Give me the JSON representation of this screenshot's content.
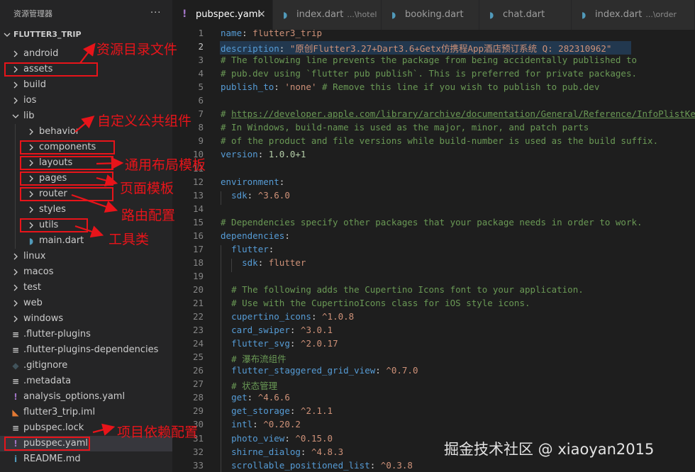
{
  "explorer": {
    "title": "资源管理器",
    "more": "···",
    "root": "FLUTTER3_TRIP",
    "items": [
      {
        "label": "android",
        "type": "folder",
        "icon": "chevron-right-icon"
      },
      {
        "label": "assets",
        "type": "folder",
        "icon": "chevron-right-icon"
      },
      {
        "label": "build",
        "type": "folder",
        "icon": "chevron-right-icon"
      },
      {
        "label": "ios",
        "type": "folder",
        "icon": "chevron-right-icon"
      },
      {
        "label": "lib",
        "type": "folder-open",
        "icon": "chevron-down-icon"
      },
      {
        "label": "behavior",
        "type": "folder",
        "icon": "chevron-right-icon"
      },
      {
        "label": "components",
        "type": "folder",
        "icon": "chevron-right-icon"
      },
      {
        "label": "layouts",
        "type": "folder",
        "icon": "chevron-right-icon"
      },
      {
        "label": "pages",
        "type": "folder",
        "icon": "chevron-right-icon"
      },
      {
        "label": "router",
        "type": "folder",
        "icon": "chevron-right-icon"
      },
      {
        "label": "styles",
        "type": "folder",
        "icon": "chevron-right-icon"
      },
      {
        "label": "utils",
        "type": "folder",
        "icon": "chevron-right-icon"
      },
      {
        "label": "main.dart",
        "type": "dart",
        "icon": "dart-file-icon"
      },
      {
        "label": "linux",
        "type": "folder",
        "icon": "chevron-right-icon"
      },
      {
        "label": "macos",
        "type": "folder",
        "icon": "chevron-right-icon"
      },
      {
        "label": "test",
        "type": "folder",
        "icon": "chevron-right-icon"
      },
      {
        "label": "web",
        "type": "folder",
        "icon": "chevron-right-icon"
      },
      {
        "label": "windows",
        "type": "folder",
        "icon": "chevron-right-icon"
      },
      {
        "label": ".flutter-plugins",
        "type": "lines",
        "icon": "text-file-icon"
      },
      {
        "label": ".flutter-plugins-dependencies",
        "type": "lines",
        "icon": "text-file-icon"
      },
      {
        "label": ".gitignore",
        "type": "git",
        "icon": "git-file-icon"
      },
      {
        "label": ".metadata",
        "type": "lines",
        "icon": "text-file-icon"
      },
      {
        "label": "analysis_options.yaml",
        "type": "yaml",
        "icon": "yaml-file-icon"
      },
      {
        "label": "flutter3_trip.iml",
        "type": "iml",
        "icon": "rss-file-icon"
      },
      {
        "label": "pubspec.lock",
        "type": "lines",
        "icon": "text-file-icon"
      },
      {
        "label": "pubspec.yaml",
        "type": "yaml",
        "icon": "yaml-file-icon",
        "selected": true
      },
      {
        "label": "README.md",
        "type": "info",
        "icon": "info-file-icon"
      }
    ]
  },
  "tabs": [
    {
      "label": "pubspec.yaml",
      "desc": "",
      "icon": "yaml-file-icon",
      "active": true,
      "close": "×"
    },
    {
      "label": "index.dart",
      "desc": "...\\hotel",
      "icon": "dart-file-icon",
      "active": false
    },
    {
      "label": "booking.dart",
      "desc": "",
      "icon": "dart-file-icon",
      "active": false
    },
    {
      "label": "chat.dart",
      "desc": "",
      "icon": "dart-file-icon",
      "active": false
    },
    {
      "label": "index.dart",
      "desc": "...\\order",
      "icon": "dart-file-icon",
      "active": false
    }
  ],
  "editor": {
    "current_line": 2,
    "lines": [
      [
        [
          "k",
          "name"
        ],
        [
          "p",
          ": "
        ],
        [
          "s",
          "flutter3_trip"
        ]
      ],
      [
        [
          "k",
          "description"
        ],
        [
          "p",
          ": "
        ],
        [
          "s",
          "\"原创Flutter3.27+Dart3.6+Getx仿携程App酒店预订系统 Q: 282310962\""
        ]
      ],
      [
        [
          "c",
          "# The following line prevents the package from being accidentally published to"
        ]
      ],
      [
        [
          "c",
          "# pub.dev using `flutter pub publish`. This is preferred for private packages."
        ]
      ],
      [
        [
          "k",
          "publish_to"
        ],
        [
          "p",
          ": "
        ],
        [
          "s",
          "'none'"
        ],
        [
          "p",
          " "
        ],
        [
          "c",
          "# Remove this line if you wish to publish to pub.dev"
        ]
      ],
      [],
      [
        [
          "c",
          "# "
        ],
        [
          "u",
          "https://developer.apple.com/library/archive/documentation/General/Reference/InfoPlistKeyReference"
        ]
      ],
      [
        [
          "c",
          "# In Windows, build-name is used as the major, minor, and patch parts"
        ]
      ],
      [
        [
          "c",
          "# of the product and file versions while build-number is used as the build suffix."
        ]
      ],
      [
        [
          "k",
          "version"
        ],
        [
          "p",
          ": "
        ],
        [
          "n",
          "1.0.0+1"
        ]
      ],
      [],
      [
        [
          "k",
          "environment"
        ],
        [
          "p",
          ":"
        ]
      ],
      [
        [
          "p",
          "  "
        ],
        [
          "k",
          "sdk"
        ],
        [
          "p",
          ": "
        ],
        [
          "s",
          "^3.6.0"
        ]
      ],
      [],
      [
        [
          "c",
          "# Dependencies specify other packages that your package needs in order to work."
        ]
      ],
      [
        [
          "k",
          "dependencies"
        ],
        [
          "p",
          ":"
        ]
      ],
      [
        [
          "p",
          "  "
        ],
        [
          "k",
          "flutter"
        ],
        [
          "p",
          ":"
        ]
      ],
      [
        [
          "p",
          "    "
        ],
        [
          "k",
          "sdk"
        ],
        [
          "p",
          ": "
        ],
        [
          "s",
          "flutter"
        ]
      ],
      [],
      [
        [
          "p",
          "  "
        ],
        [
          "c",
          "# The following adds the Cupertino Icons font to your application."
        ]
      ],
      [
        [
          "p",
          "  "
        ],
        [
          "c",
          "# Use with the CupertinoIcons class for iOS style icons."
        ]
      ],
      [
        [
          "p",
          "  "
        ],
        [
          "k",
          "cupertino_icons"
        ],
        [
          "p",
          ": "
        ],
        [
          "s",
          "^1.0.8"
        ]
      ],
      [
        [
          "p",
          "  "
        ],
        [
          "k",
          "card_swiper"
        ],
        [
          "p",
          ": "
        ],
        [
          "s",
          "^3.0.1"
        ]
      ],
      [
        [
          "p",
          "  "
        ],
        [
          "k",
          "flutter_svg"
        ],
        [
          "p",
          ": "
        ],
        [
          "s",
          "^2.0.17"
        ]
      ],
      [
        [
          "p",
          "  "
        ],
        [
          "c",
          "# 瀑布流组件"
        ]
      ],
      [
        [
          "p",
          "  "
        ],
        [
          "k",
          "flutter_staggered_grid_view"
        ],
        [
          "p",
          ": "
        ],
        [
          "s",
          "^0.7.0"
        ]
      ],
      [
        [
          "p",
          "  "
        ],
        [
          "c",
          "# 状态管理"
        ]
      ],
      [
        [
          "p",
          "  "
        ],
        [
          "k",
          "get"
        ],
        [
          "p",
          ": "
        ],
        [
          "s",
          "^4.6.6"
        ]
      ],
      [
        [
          "p",
          "  "
        ],
        [
          "k",
          "get_storage"
        ],
        [
          "p",
          ": "
        ],
        [
          "s",
          "^2.1.1"
        ]
      ],
      [
        [
          "p",
          "  "
        ],
        [
          "k",
          "intl"
        ],
        [
          "p",
          ": "
        ],
        [
          "s",
          "^0.20.2"
        ]
      ],
      [
        [
          "p",
          "  "
        ],
        [
          "k",
          "photo_view"
        ],
        [
          "p",
          ": "
        ],
        [
          "s",
          "^0.15.0"
        ]
      ],
      [
        [
          "p",
          "  "
        ],
        [
          "k",
          "shirne_dialog"
        ],
        [
          "p",
          ": "
        ],
        [
          "s",
          "^4.8.3"
        ]
      ],
      [
        [
          "p",
          "  "
        ],
        [
          "k",
          "scrollable_positioned_list"
        ],
        [
          "p",
          ": "
        ],
        [
          "s",
          "^0.3.8"
        ]
      ]
    ]
  },
  "annotations": [
    {
      "text": "资源目录文件",
      "target": "assets"
    },
    {
      "text": "自定义公共组件",
      "target": "components"
    },
    {
      "text": "通用布局模板",
      "target": "layouts"
    },
    {
      "text": "页面模板",
      "target": "pages"
    },
    {
      "text": "路由配置",
      "target": "router"
    },
    {
      "text": "工具类",
      "target": "utils"
    },
    {
      "text": "项目依赖配置",
      "target": "pubspec.yaml"
    }
  ],
  "watermark": "掘金技术社区 @ xiaoyan2015",
  "colors": {
    "annotation": "#e8141a",
    "selection": "#264f78",
    "keyword": "#569cd6",
    "string": "#ce9178",
    "comment": "#6a9955",
    "number": "#b5cea8"
  }
}
